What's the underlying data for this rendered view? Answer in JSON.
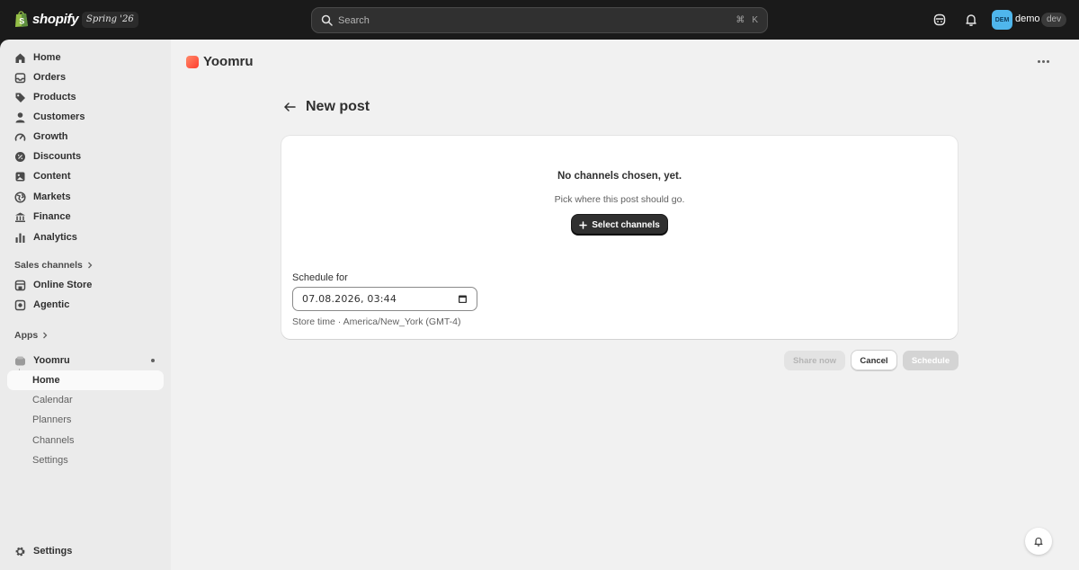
{
  "topbar": {
    "brand": "shopify",
    "edition": "Spring '26",
    "search_placeholder": "Search",
    "shortcut_cmd": "⌘",
    "shortcut_key": "K",
    "avatar_initials": "DEM",
    "store_name": "demo",
    "store_badge": "dev"
  },
  "sidebar": {
    "items": [
      {
        "label": "Home",
        "icon": "home-icon"
      },
      {
        "label": "Orders",
        "icon": "inbox-icon"
      },
      {
        "label": "Products",
        "icon": "tag-icon"
      },
      {
        "label": "Customers",
        "icon": "person-icon"
      },
      {
        "label": "Growth",
        "icon": "gauge-icon"
      },
      {
        "label": "Discounts",
        "icon": "discount-icon"
      },
      {
        "label": "Content",
        "icon": "content-icon"
      },
      {
        "label": "Markets",
        "icon": "globe-icon"
      },
      {
        "label": "Finance",
        "icon": "bank-icon"
      },
      {
        "label": "Analytics",
        "icon": "bar-chart-icon"
      }
    ],
    "sales_channels_label": "Sales channels",
    "channels": [
      {
        "label": "Online Store",
        "icon": "store-icon"
      },
      {
        "label": "Agentic",
        "icon": "agent-icon"
      }
    ],
    "apps_label": "Apps",
    "app": {
      "label": "Yoomru",
      "subitems": [
        "Home",
        "Calendar",
        "Planners",
        "Channels",
        "Settings"
      ]
    },
    "settings_label": "Settings"
  },
  "main": {
    "app_name": "Yoomru",
    "page_title": "New post",
    "card": {
      "empty_title": "No channels chosen, yet.",
      "empty_subtitle": "Pick where this post should go.",
      "select_button": "Select channels",
      "schedule_label": "Schedule for",
      "schedule_value": "07.08.2026, 03:44",
      "help_text": "Store time · America/New_York (GMT-4)"
    },
    "actions": {
      "share_now": "Share now",
      "cancel": "Cancel",
      "schedule": "Schedule"
    }
  },
  "colors": {
    "topbar_bg": "#1a1a1a",
    "sidebar_bg": "#ebebeb",
    "main_bg": "#f1f1f1",
    "primary_button": "#303030",
    "avatar_bg": "#4fb6ec",
    "app_accent": "#ff4d3a"
  }
}
